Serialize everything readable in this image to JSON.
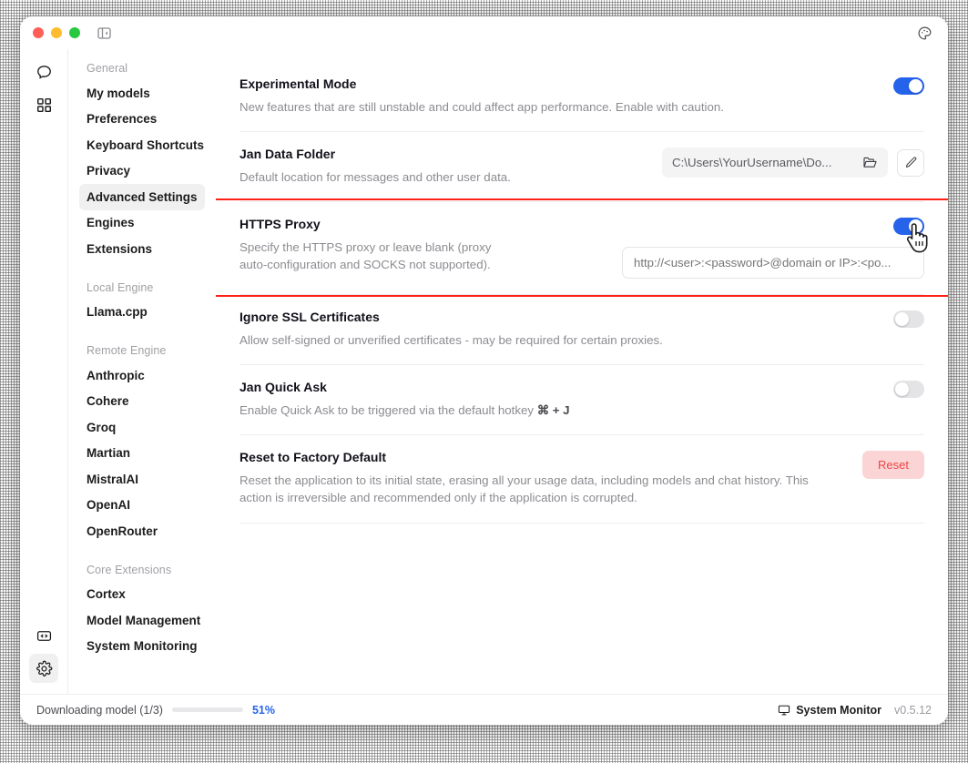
{
  "window": {
    "traffic_lights": [
      "close",
      "minimize",
      "maximize"
    ],
    "collapse_icon": "panel-collapse-icon",
    "palette_icon": "palette-icon"
  },
  "rail": {
    "top_items": [
      {
        "icon": "chat-bubble-icon",
        "name": "chat"
      },
      {
        "icon": "grid-icon",
        "name": "hub"
      }
    ],
    "bottom_items": [
      {
        "icon": "code-brackets-icon",
        "name": "developer"
      },
      {
        "icon": "gear-icon",
        "name": "settings",
        "active": true
      }
    ]
  },
  "sidebar": {
    "groups": [
      {
        "label": "General",
        "items": [
          {
            "label": "My models",
            "active": false
          },
          {
            "label": "Preferences",
            "active": false
          },
          {
            "label": "Keyboard Shortcuts",
            "active": false
          },
          {
            "label": "Privacy",
            "active": false
          },
          {
            "label": "Advanced Settings",
            "active": true
          },
          {
            "label": "Engines",
            "active": false
          },
          {
            "label": "Extensions",
            "active": false
          }
        ]
      },
      {
        "label": "Local Engine",
        "items": [
          {
            "label": "Llama.cpp",
            "active": false
          }
        ]
      },
      {
        "label": "Remote Engine",
        "items": [
          {
            "label": "Anthropic",
            "active": false
          },
          {
            "label": "Cohere",
            "active": false
          },
          {
            "label": "Groq",
            "active": false
          },
          {
            "label": "Martian",
            "active": false
          },
          {
            "label": "MistralAI",
            "active": false
          },
          {
            "label": "OpenAI",
            "active": false
          },
          {
            "label": "OpenRouter",
            "active": false
          }
        ]
      },
      {
        "label": "Core Extensions",
        "items": [
          {
            "label": "Cortex",
            "active": false
          },
          {
            "label": "Model Management",
            "active": false
          },
          {
            "label": "System Monitoring",
            "active": false
          }
        ]
      }
    ]
  },
  "settings": {
    "experimental_mode": {
      "title": "Experimental Mode",
      "desc": "New features that are still unstable and could affect app performance. Enable with caution.",
      "toggle_on": true
    },
    "data_folder": {
      "title": "Jan Data Folder",
      "desc": "Default location for messages and other user data.",
      "path": "C:\\Users\\YourUsername\\Do...",
      "folder_icon": "folder-open-icon",
      "edit_icon": "pencil-icon"
    },
    "https_proxy": {
      "title": "HTTPS Proxy",
      "desc_line1": "Specify the HTTPS proxy or leave blank (proxy",
      "desc_line2": "auto-configuration and SOCKS not supported).",
      "toggle_on": true,
      "input_placeholder": "http://<user>:<password>@domain or IP>:<po...",
      "input_value": "",
      "highlighted": true,
      "highlight_color": "#ff2116"
    },
    "ignore_ssl": {
      "title": "Ignore SSL Certificates",
      "desc": "Allow self-signed or unverified certificates - may be required for certain proxies.",
      "toggle_on": false
    },
    "quick_ask": {
      "title": "Jan Quick Ask",
      "desc_prefix": "Enable Quick Ask to be triggered via the default hotkey ",
      "hotkey": "⌘ + J",
      "toggle_on": false
    },
    "reset": {
      "title": "Reset to Factory Default",
      "desc": "Reset the application to its initial state, erasing all your usage data, including models and chat history. This action is irreversible and recommended only if the application is corrupted.",
      "button_label": "Reset",
      "button_color": "#ef4444"
    }
  },
  "statusbar": {
    "download_label": "Downloading model (1/3)",
    "progress_percent": 51,
    "progress_fill_percent": 36,
    "percent_label": "51%",
    "system_monitor_label": "System Monitor",
    "system_monitor_icon": "monitor-icon",
    "version": "v0.5.12",
    "accent_color": "#2563eb"
  }
}
